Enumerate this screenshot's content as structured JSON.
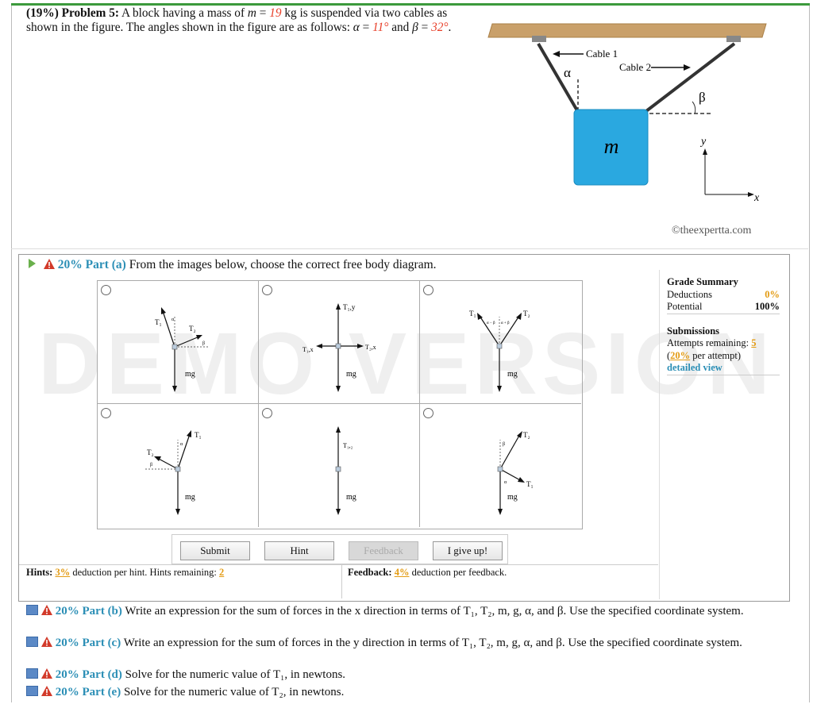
{
  "problem": {
    "pct": "(19%)",
    "label": "Problem 5:",
    "text1": "A block having a mass of",
    "m_sym": "m",
    "eq": "=",
    "mass": "19",
    "text2": "kg is suspended via two cables as shown in the figure. The angles shown in the figure are as follows:",
    "alpha_sym": "α",
    "alpha_val": "11",
    "and": "and",
    "beta_sym": "β",
    "beta_val": "32",
    "deg": "°"
  },
  "figure": {
    "cable1": "Cable 1",
    "cable2": "Cable 2",
    "alpha": "α",
    "beta": "β",
    "block": "m",
    "yaxis": "y",
    "xaxis": "x",
    "copyright": "©theexpertta.com"
  },
  "part_a": {
    "label": "20% Part (a)",
    "text": "From the images below, choose the correct free body diagram."
  },
  "fbd_labels": {
    "t1": "T₁",
    "t2": "T₂",
    "t1y": "T₁,y",
    "t1x": "T₁,x",
    "t2x": "T₂,x",
    "t12": "T₁,₂",
    "mg": "mg",
    "a": "α",
    "b": "β",
    "ab": "α − β",
    "apb": "α + β"
  },
  "grade": {
    "title": "Grade Summary",
    "deductions_label": "Deductions",
    "deductions_val": "0%",
    "potential_label": "Potential",
    "potential_val": "100%",
    "submissions_title": "Submissions",
    "attempts_label": "Attempts remaining:",
    "attempts_val": "5",
    "per_val": "20%",
    "per_label": "per attempt)",
    "detail": "detailed view"
  },
  "buttons": {
    "submit": "Submit",
    "hint": "Hint",
    "feedback": "Feedback",
    "give_up": "I give up!"
  },
  "hints": {
    "label": "Hints:",
    "pct": "3%",
    "text": "deduction per hint. Hints remaining:",
    "remaining": "2"
  },
  "feedback": {
    "label": "Feedback:",
    "pct": "4%",
    "text": "deduction per feedback."
  },
  "watermark": "DEMO VERSION",
  "parts": [
    {
      "label": "20% Part (b)",
      "text": "Write an expression for the sum of forces in the x direction in terms of T₁, T₂, m, g, α, and β. Use the specified coordinate system."
    },
    {
      "label": "20% Part (c)",
      "text": "Write an expression for the sum of forces in the y direction in terms of T₁, T₂, m, g, α, and β. Use the specified coordinate system."
    },
    {
      "label": "20% Part (d)",
      "text": "Solve for the numeric value of T₁, in newtons."
    },
    {
      "label": "20% Part (e)",
      "text": "Solve for the numeric value of T₂, in newtons."
    }
  ]
}
